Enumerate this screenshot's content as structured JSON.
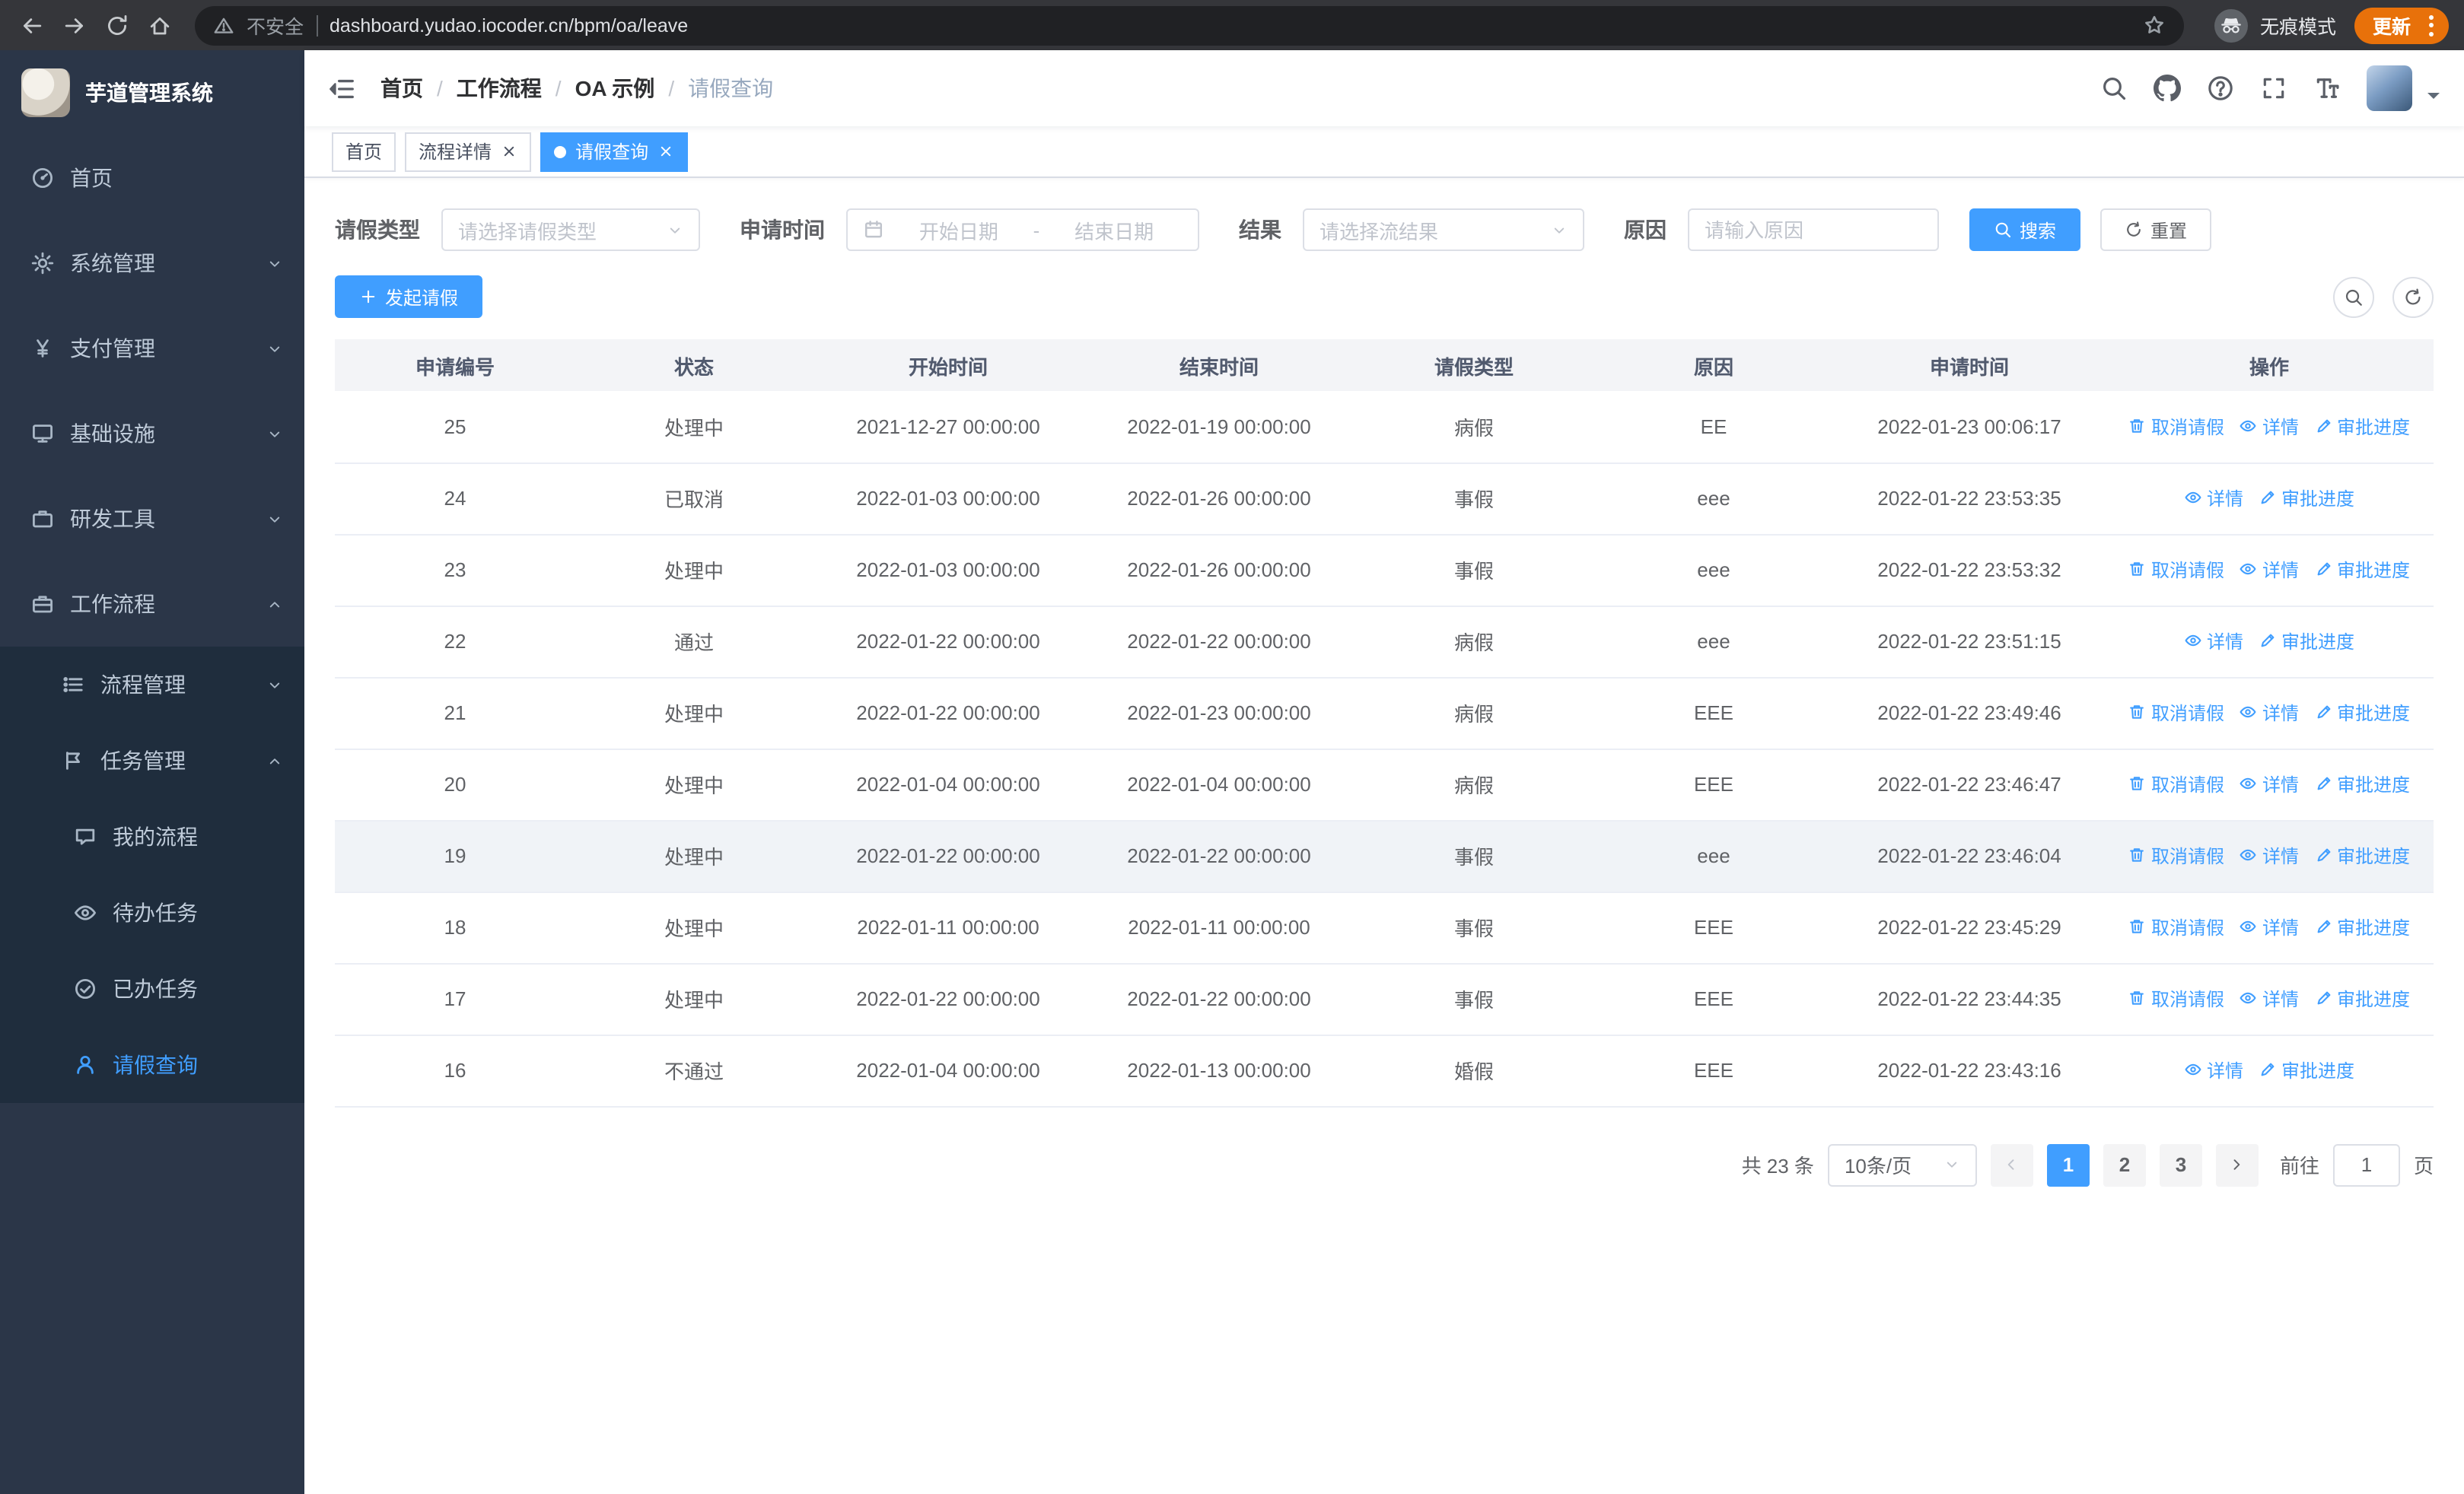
{
  "colors": {
    "accent": "#409eff",
    "sidebar_bg": "#2b3648",
    "submenu_bg": "#1f2d3d",
    "update_pill": "#e8710a"
  },
  "browser": {
    "security_label": "不安全",
    "url": "dashboard.yudao.iocoder.cn/bpm/oa/leave",
    "incognito_label": "无痕模式",
    "update_label": "更新"
  },
  "sidebar": {
    "title": "芋道管理系统",
    "items": [
      {
        "label": "首页",
        "icon": "dashboard-icon",
        "level": 1
      },
      {
        "label": "系统管理",
        "icon": "gear-icon",
        "level": 1,
        "chevron": "down"
      },
      {
        "label": "支付管理",
        "icon": "yen-icon",
        "level": 1,
        "chevron": "down"
      },
      {
        "label": "基础设施",
        "icon": "monitor-icon",
        "level": 1,
        "chevron": "down"
      },
      {
        "label": "研发工具",
        "icon": "toolbox-icon",
        "level": 1,
        "chevron": "down"
      },
      {
        "label": "工作流程",
        "icon": "briefcase-icon",
        "level": 1,
        "chevron": "up"
      },
      {
        "label": "流程管理",
        "icon": "list-icon",
        "level": 2,
        "chevron": "down"
      },
      {
        "label": "任务管理",
        "icon": "flag-icon",
        "level": 2,
        "chevron": "up"
      },
      {
        "label": "我的流程",
        "icon": "chat-icon",
        "level": 3
      },
      {
        "label": "待办任务",
        "icon": "eye-icon",
        "level": 3
      },
      {
        "label": "已办任务",
        "icon": "check-circle-icon",
        "level": 3
      },
      {
        "label": "请假查询",
        "icon": "user-icon",
        "level": 3,
        "active": true
      }
    ]
  },
  "header": {
    "breadcrumb": [
      "首页",
      "工作流程",
      "OA 示例",
      "请假查询"
    ],
    "separator": "/"
  },
  "tabs": [
    {
      "label": "首页",
      "closable": false,
      "active": false
    },
    {
      "label": "流程详情",
      "closable": true,
      "active": false
    },
    {
      "label": "请假查询",
      "closable": true,
      "active": true
    }
  ],
  "filters": {
    "leave_type_label": "请假类型",
    "leave_type_placeholder": "请选择请假类型",
    "apply_time_label": "申请时间",
    "date_start_placeholder": "开始日期",
    "date_separator": "-",
    "date_end_placeholder": "结束日期",
    "result_label": "结果",
    "result_placeholder": "请选择流结果",
    "reason_label": "原因",
    "reason_placeholder": "请输入原因",
    "search_label": "搜索",
    "reset_label": "重置"
  },
  "toolbar": {
    "create_label": "发起请假"
  },
  "table": {
    "columns": [
      "申请编号",
      "状态",
      "开始时间",
      "结束时间",
      "请假类型",
      "原因",
      "申请时间",
      "操作"
    ],
    "action_labels": {
      "cancel": "取消请假",
      "detail": "详情",
      "progress": "审批进度"
    },
    "rows": [
      {
        "id": "25",
        "status": "处理中",
        "start": "2021-12-27 00:00:00",
        "end": "2022-01-19 00:00:00",
        "type": "病假",
        "reason": "EE",
        "applied": "2022-01-23 00:06:17",
        "actions": [
          "cancel",
          "detail",
          "progress"
        ]
      },
      {
        "id": "24",
        "status": "已取消",
        "start": "2022-01-03 00:00:00",
        "end": "2022-01-26 00:00:00",
        "type": "事假",
        "reason": "eee",
        "applied": "2022-01-22 23:53:35",
        "actions": [
          "detail",
          "progress"
        ]
      },
      {
        "id": "23",
        "status": "处理中",
        "start": "2022-01-03 00:00:00",
        "end": "2022-01-26 00:00:00",
        "type": "事假",
        "reason": "eee",
        "applied": "2022-01-22 23:53:32",
        "actions": [
          "cancel",
          "detail",
          "progress"
        ]
      },
      {
        "id": "22",
        "status": "通过",
        "start": "2022-01-22 00:00:00",
        "end": "2022-01-22 00:00:00",
        "type": "病假",
        "reason": "eee",
        "applied": "2022-01-22 23:51:15",
        "actions": [
          "detail",
          "progress"
        ]
      },
      {
        "id": "21",
        "status": "处理中",
        "start": "2022-01-22 00:00:00",
        "end": "2022-01-23 00:00:00",
        "type": "病假",
        "reason": "EEE",
        "applied": "2022-01-22 23:49:46",
        "actions": [
          "cancel",
          "detail",
          "progress"
        ]
      },
      {
        "id": "20",
        "status": "处理中",
        "start": "2022-01-04 00:00:00",
        "end": "2022-01-04 00:00:00",
        "type": "病假",
        "reason": "EEE",
        "applied": "2022-01-22 23:46:47",
        "actions": [
          "cancel",
          "detail",
          "progress"
        ]
      },
      {
        "id": "19",
        "status": "处理中",
        "start": "2022-01-22 00:00:00",
        "end": "2022-01-22 00:00:00",
        "type": "事假",
        "reason": "eee",
        "applied": "2022-01-22 23:46:04",
        "actions": [
          "cancel",
          "detail",
          "progress"
        ],
        "hover": true
      },
      {
        "id": "18",
        "status": "处理中",
        "start": "2022-01-11 00:00:00",
        "end": "2022-01-11 00:00:00",
        "type": "事假",
        "reason": "EEE",
        "applied": "2022-01-22 23:45:29",
        "actions": [
          "cancel",
          "detail",
          "progress"
        ]
      },
      {
        "id": "17",
        "status": "处理中",
        "start": "2022-01-22 00:00:00",
        "end": "2022-01-22 00:00:00",
        "type": "事假",
        "reason": "EEE",
        "applied": "2022-01-22 23:44:35",
        "actions": [
          "cancel",
          "detail",
          "progress"
        ]
      },
      {
        "id": "16",
        "status": "不通过",
        "start": "2022-01-04 00:00:00",
        "end": "2022-01-13 00:00:00",
        "type": "婚假",
        "reason": "EEE",
        "applied": "2022-01-22 23:43:16",
        "actions": [
          "detail",
          "progress"
        ]
      }
    ]
  },
  "pagination": {
    "total_text": "共 23 条",
    "page_size": "10条/页",
    "pages": [
      "1",
      "2",
      "3"
    ],
    "active_page": "1",
    "goto_label": "前往",
    "goto_value": "1",
    "goto_suffix": "页"
  }
}
